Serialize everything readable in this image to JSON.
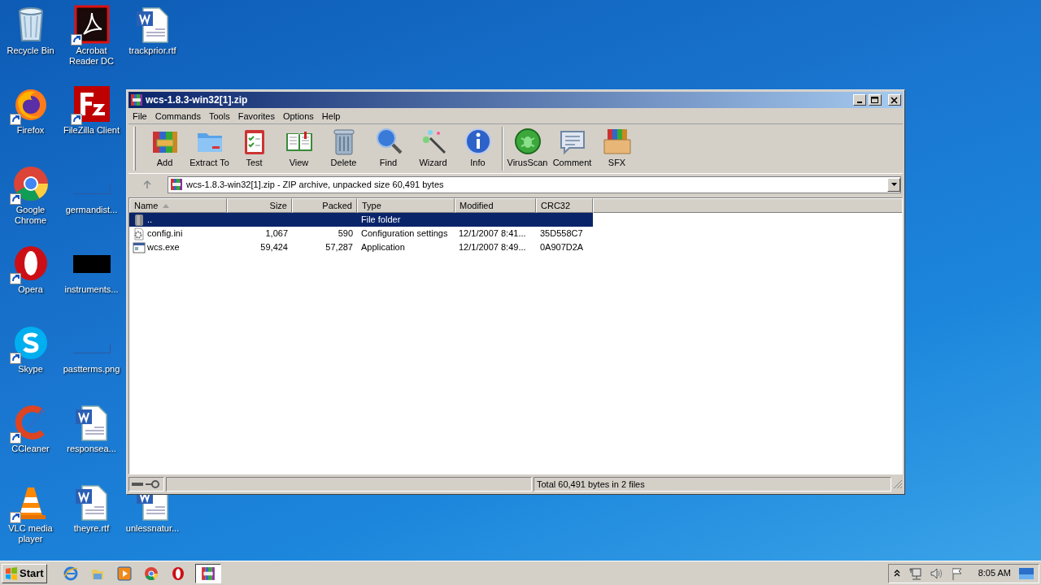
{
  "desktop": {
    "columns": [
      [
        {
          "label": "Recycle Bin",
          "kind": "recycle",
          "shortcut": false
        },
        {
          "label": "Firefox",
          "kind": "firefox",
          "shortcut": true
        },
        {
          "label": "Google Chrome",
          "kind": "chrome",
          "shortcut": true
        },
        {
          "label": "Opera",
          "kind": "opera",
          "shortcut": true
        },
        {
          "label": "Skype",
          "kind": "skype",
          "shortcut": true
        },
        {
          "label": "CCleaner",
          "kind": "ccleaner",
          "shortcut": true
        },
        {
          "label": "VLC media player",
          "kind": "vlc",
          "shortcut": true
        }
      ],
      [
        {
          "label": "Acrobat Reader DC",
          "kind": "pdf",
          "shortcut": true
        },
        {
          "label": "FileZilla Client",
          "kind": "filezilla",
          "shortcut": true
        },
        {
          "label": "germandist...",
          "kind": "blank",
          "shortcut": false
        },
        {
          "label": "instruments...",
          "kind": "black",
          "shortcut": false
        },
        {
          "label": "pastterms.png",
          "kind": "blank",
          "shortcut": false
        },
        {
          "label": "responsea...",
          "kind": "word",
          "shortcut": false
        },
        {
          "label": "theyre.rtf",
          "kind": "word",
          "shortcut": false
        }
      ],
      [
        {
          "label": "trackprior.rtf",
          "kind": "word",
          "shortcut": false
        },
        null,
        null,
        null,
        null,
        null,
        {
          "label": "unlessnatur...",
          "kind": "word",
          "shortcut": false,
          "partly_hidden": true
        }
      ]
    ]
  },
  "window": {
    "title": "wcs-1.8.3-win32[1].zip",
    "menu": [
      "File",
      "Commands",
      "Tools",
      "Favorites",
      "Options",
      "Help"
    ],
    "toolbar": [
      [
        {
          "label": "Add",
          "kind": "add"
        },
        {
          "label": "Extract To",
          "kind": "extract"
        },
        {
          "label": "Test",
          "kind": "test"
        },
        {
          "label": "View",
          "kind": "view"
        },
        {
          "label": "Delete",
          "kind": "delete"
        },
        {
          "label": "Find",
          "kind": "find"
        },
        {
          "label": "Wizard",
          "kind": "wizard"
        },
        {
          "label": "Info",
          "kind": "info"
        }
      ],
      [
        {
          "label": "VirusScan",
          "kind": "virus"
        },
        {
          "label": "Comment",
          "kind": "comment"
        },
        {
          "label": "SFX",
          "kind": "sfx"
        }
      ]
    ],
    "address": "wcs-1.8.3-win32[1].zip - ZIP archive, unpacked size 60,491 bytes",
    "table": {
      "columns": [
        {
          "label": "Name",
          "sorted": true
        },
        {
          "label": "Size",
          "sorted": false
        },
        {
          "label": "Packed",
          "sorted": false
        },
        {
          "label": "Type",
          "sorted": false
        },
        {
          "label": "Modified",
          "sorted": false
        },
        {
          "label": "CRC32",
          "sorted": false
        }
      ],
      "rows": [
        {
          "kind": "folder",
          "name": "..",
          "type": "File folder",
          "selected": true
        },
        {
          "kind": "settings",
          "name": "config.ini",
          "size": "1,067",
          "packed": "590",
          "type": "Configuration settings",
          "modified": "12/1/2007 8:41...",
          "crc32": "35D558C7",
          "selected": false
        },
        {
          "kind": "app",
          "name": "wcs.exe",
          "size": "59,424",
          "packed": "57,287",
          "type": "Application",
          "modified": "12/1/2007 8:49...",
          "crc32": "0A907D2A",
          "selected": false
        }
      ]
    },
    "status_bar": "Total 60,491 bytes in 2 files"
  },
  "taskbar": {
    "start": "Start",
    "pinned": [
      {
        "kind": "ie"
      },
      {
        "kind": "explorer"
      },
      {
        "kind": "media"
      },
      {
        "kind": "chrome"
      },
      {
        "kind": "opera"
      }
    ],
    "tasks": [
      {
        "kind": "winrar",
        "active": true
      }
    ],
    "time": "8:05 AM"
  }
}
